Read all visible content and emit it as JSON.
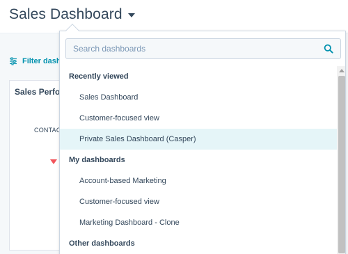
{
  "header": {
    "title": "Sales Dashboard",
    "caret_icon": "caret-down-icon"
  },
  "toolbar": {
    "filter_label": "Filter dash",
    "filter_icon": "sliders-icon"
  },
  "report_card": {
    "title": "Sales Perfor",
    "axis_label": "CONTAC",
    "marker_color": "#f2545b"
  },
  "dropdown": {
    "search": {
      "placeholder": "Search dashboards",
      "value": "",
      "icon": "search-icon"
    },
    "groups": [
      {
        "label": "Recently viewed",
        "items": [
          {
            "label": "Sales Dashboard",
            "active": false
          },
          {
            "label": "Customer-focused view",
            "active": false
          },
          {
            "label": "Private Sales Dashboard (Casper)",
            "active": true
          }
        ]
      },
      {
        "label": "My dashboards",
        "items": [
          {
            "label": "Account-based Marketing",
            "active": false
          },
          {
            "label": "Customer-focused view",
            "active": false
          },
          {
            "label": "Marketing Dashboard - Clone",
            "active": false
          }
        ]
      },
      {
        "label": "Other dashboards",
        "items": []
      }
    ]
  },
  "colors": {
    "title_text": "#33475b",
    "link": "#0091ae",
    "highlight": "#e5f5f8",
    "border": "#cbd6e2"
  }
}
